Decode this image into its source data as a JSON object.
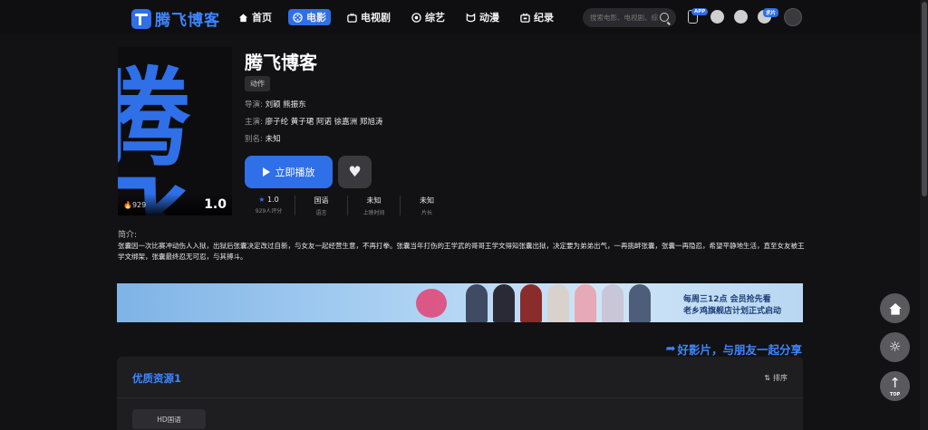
{
  "header": {
    "logo_text": "腾飞博客",
    "nav": [
      {
        "label": "首页",
        "icon": "home-icon",
        "active": false
      },
      {
        "label": "电影",
        "icon": "film-icon",
        "active": true
      },
      {
        "label": "电视剧",
        "icon": "tv-icon",
        "active": false
      },
      {
        "label": "综艺",
        "icon": "variety-icon",
        "active": false
      },
      {
        "label": "动漫",
        "icon": "anime-icon",
        "active": false
      },
      {
        "label": "纪录",
        "icon": "documentary-icon",
        "active": false
      }
    ],
    "search_placeholder": "搜索电影、电视剧、综艺",
    "app_badge": "APP",
    "request_badge": "求片"
  },
  "movie": {
    "title": "腾飞博客",
    "genre": "动作",
    "director_label": "导演:",
    "director": "刘颖 熊振东",
    "cast_label": "主演:",
    "cast": "廖子纶 黄子珺 阿诺 徐嘉洲 郑旭涛",
    "alias_label": "别名:",
    "alias": "未知",
    "poster_heat": "929",
    "poster_score": "1.0",
    "play_label": "立即播放",
    "stats": [
      {
        "value": "1.0",
        "label": "929人评分"
      },
      {
        "value": "国语",
        "label": "语言"
      },
      {
        "value": "未知",
        "label": "上映时间"
      },
      {
        "value": "未知",
        "label": "片长"
      }
    ],
    "intro_label": "简介:",
    "intro": "张囊因一次比赛冲动伤人入狱，出狱后张囊决定改过自新，与女友一起经营生意，不再打拳。张囊当年打伤的王学武的哥哥王学文得知张囊出狱，决定要为弟弟出气，一再挑衅张囊，张囊一再隐忍，希望平静地生活，直至女友被王学文绑架，张囊最终忍无可忍，与其搏斗。"
  },
  "banner": {
    "line1": "每周三12点 会员抢先看",
    "line2": "老乡鸡旗舰店计划正式启动"
  },
  "share_text": "好影片，与朋友一起分享",
  "panel": {
    "title": "优质资源1",
    "sort_label": "排序",
    "episode": "HD国语"
  },
  "floating": {
    "top_label": "TOP"
  },
  "colors": {
    "accent": "#2f6fe8",
    "background": "#121214"
  }
}
